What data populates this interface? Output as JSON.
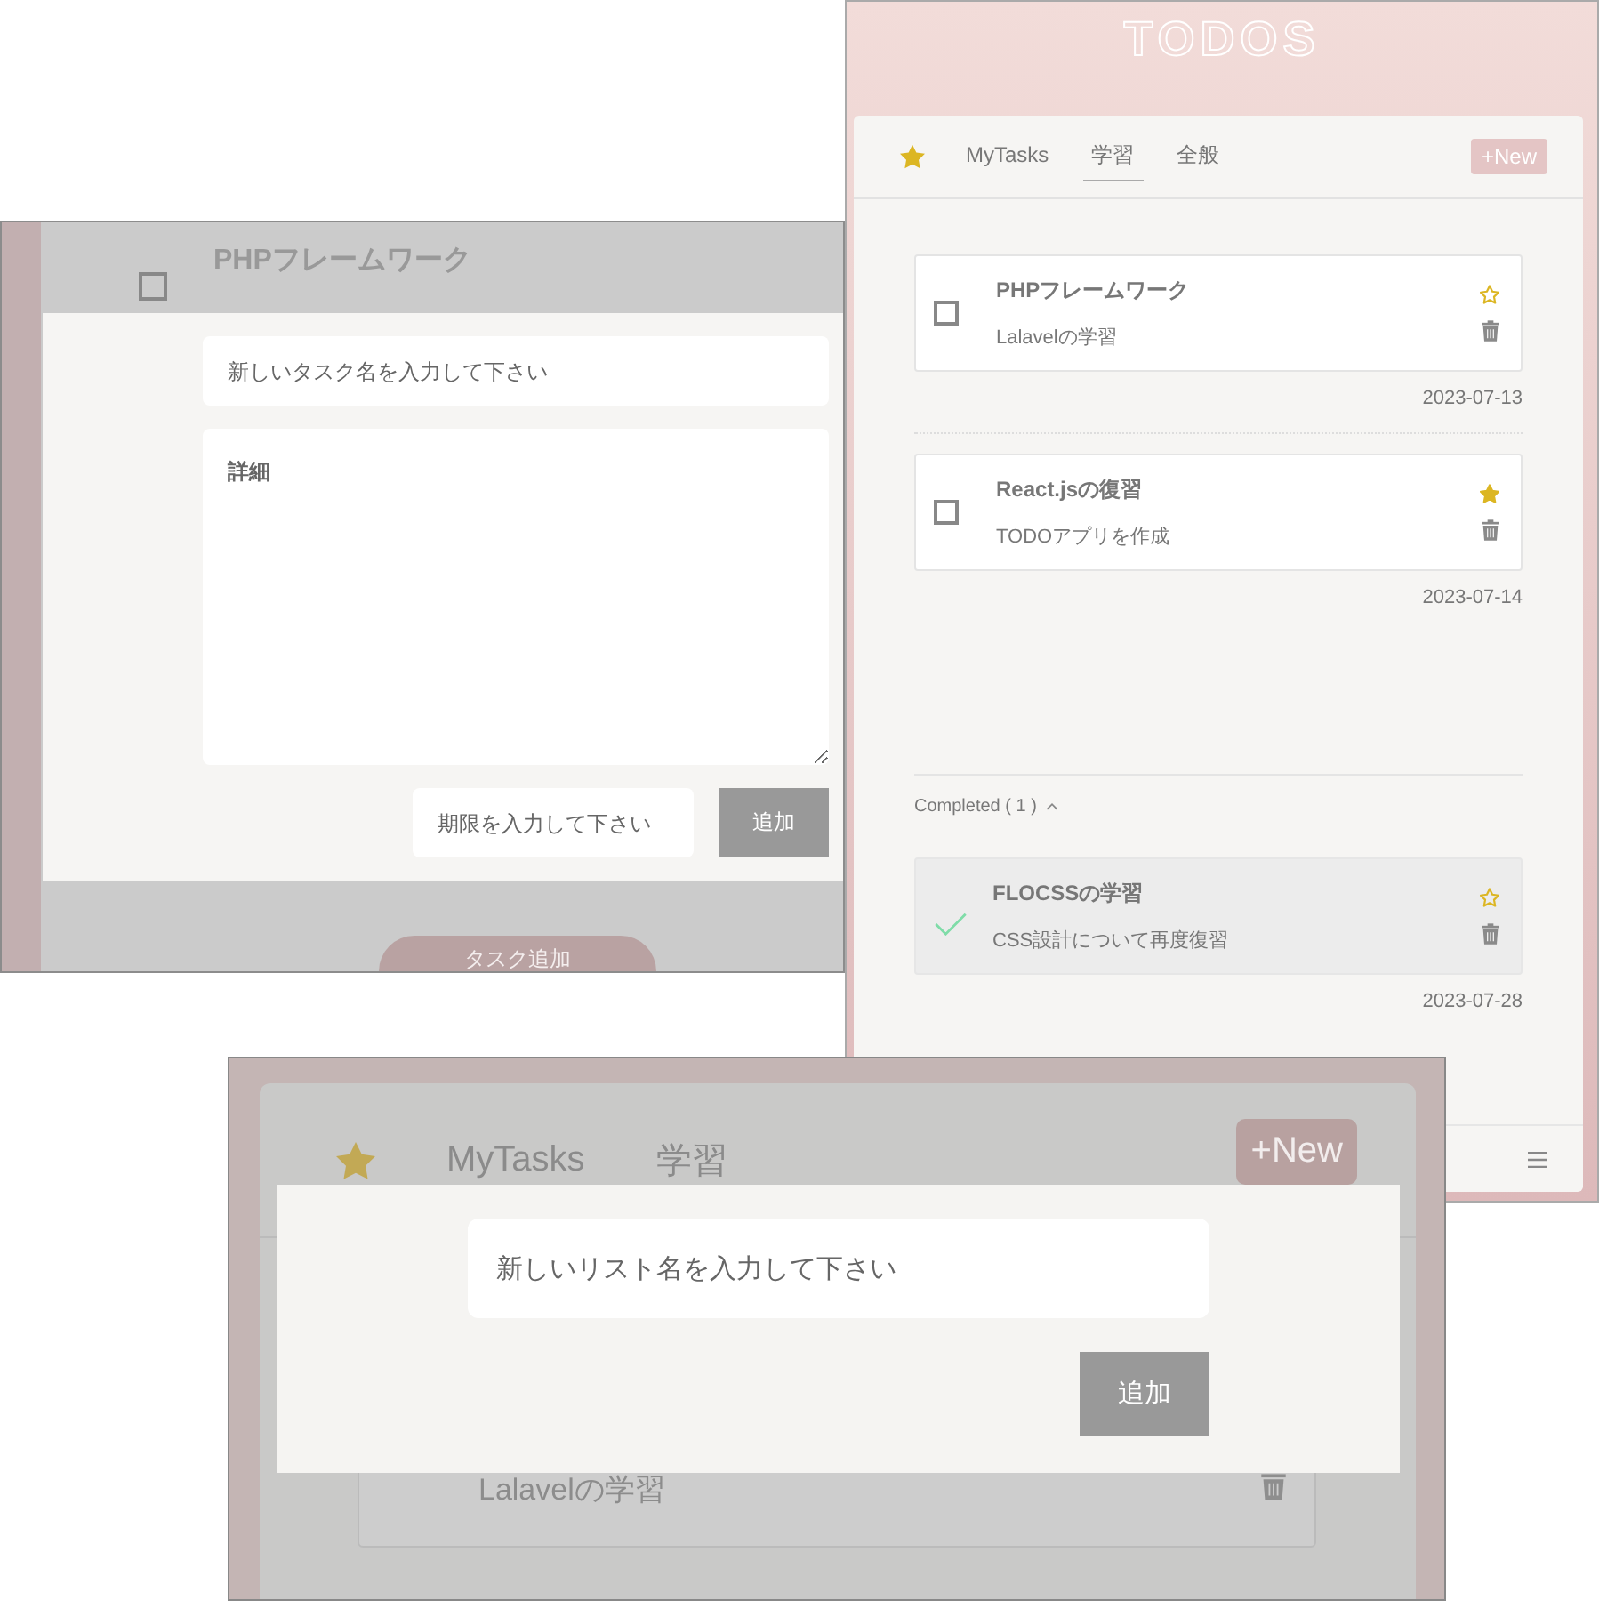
{
  "task_dialog_screen": {
    "background_task": {
      "title": "PHPフレームワーク",
      "checked": false
    },
    "dialog": {
      "title_placeholder": "新しいタスク名を入力して下さい",
      "detail_placeholder": "詳細",
      "due_placeholder": "期限を入力して下さい",
      "submit": "追加"
    },
    "add_task_button": "タスク追加"
  },
  "list_screen": {
    "app_title": "TODOS",
    "tabs": [
      {
        "label": "MyTasks",
        "selected": false
      },
      {
        "label": "学習",
        "selected": true
      },
      {
        "label": "全般",
        "selected": false
      }
    ],
    "new_button": "+New",
    "tasks": [
      {
        "title": "PHPフレームワーク",
        "note": "Lalavelの学習",
        "starred": false,
        "checked": false,
        "date": "2023-07-13"
      },
      {
        "title": "React.jsの復習",
        "note": "TODOアプリを作成",
        "starred": true,
        "checked": false,
        "date": "2023-07-14"
      }
    ],
    "completed_label": "Completed ( 1 )",
    "completed_expanded": true,
    "completed_tasks": [
      {
        "title": "FLOCSSの学習",
        "note": "CSS設計について再度復習",
        "starred": false,
        "checked": true,
        "date": "2023-07-28"
      }
    ]
  },
  "list_dialog_screen": {
    "tabs": [
      "MyTasks",
      "学習"
    ],
    "new_button": "+New",
    "background_task_note": "Lalavelの学習",
    "dialog": {
      "placeholder": "新しいリスト名を入力して下さい",
      "submit": "追加"
    }
  }
}
